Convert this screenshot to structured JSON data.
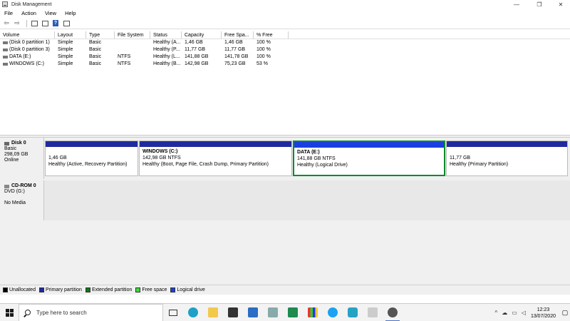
{
  "window": {
    "title": "Disk Management",
    "minimize": "—",
    "restore": "❐",
    "close": "✕"
  },
  "menu": [
    "File",
    "Action",
    "View",
    "Help"
  ],
  "toolbar": {
    "back": "⇦",
    "forward": "⇨",
    "help": "?"
  },
  "volume_table": {
    "columns": [
      "Volume",
      "Layout",
      "Type",
      "File System",
      "Status",
      "Capacity",
      "Free Spa...",
      "% Free"
    ],
    "rows": [
      {
        "volume": "(Disk 0 partition 1)",
        "layout": "Simple",
        "type": "Basic",
        "fs": "",
        "status": "Healthy (A...",
        "capacity": "1,46 GB",
        "free": "1,46 GB",
        "pct": "100 %"
      },
      {
        "volume": "(Disk 0 partition 3)",
        "layout": "Simple",
        "type": "Basic",
        "fs": "",
        "status": "Healthy (P...",
        "capacity": "11,77 GB",
        "free": "11,77 GB",
        "pct": "100 %"
      },
      {
        "volume": "DATA (E:)",
        "layout": "Simple",
        "type": "Basic",
        "fs": "NTFS",
        "status": "Healthy (L...",
        "capacity": "141,88 GB",
        "free": "141,78 GB",
        "pct": "100 %"
      },
      {
        "volume": "WINDOWS (C:)",
        "layout": "Simple",
        "type": "Basic",
        "fs": "NTFS",
        "status": "Healthy (B...",
        "capacity": "142,98 GB",
        "free": "75,23 GB",
        "pct": "53 %"
      }
    ]
  },
  "disk0": {
    "name": "Disk 0",
    "type": "Basic",
    "size": "298,09 GB",
    "state": "Online",
    "partitions": [
      {
        "title": "",
        "size": "1,46 GB",
        "status": "Healthy (Active, Recovery Partition)"
      },
      {
        "title": "WINDOWS  (C:)",
        "size": "142,98 GB NTFS",
        "status": "Healthy (Boot, Page File, Crash Dump, Primary Partition)"
      },
      {
        "title": "DATA  (E:)",
        "size": "141,88 GB NTFS",
        "status": "Healthy (Logical Drive)"
      },
      {
        "title": "",
        "size": "11,77 GB",
        "status": "Healthy (Primary Partition)"
      }
    ]
  },
  "cdrom0": {
    "name": "CD-ROM 0",
    "drive": "DVD (G:)",
    "media": "No Media"
  },
  "legend": [
    {
      "label": "Unallocated",
      "color": "#000000"
    },
    {
      "label": "Primary partition",
      "color": "#1e2a9e"
    },
    {
      "label": "Extended partition",
      "color": "#0a7a20"
    },
    {
      "label": "Free space",
      "color": "#3ddc3d"
    },
    {
      "label": "Logical drive",
      "color": "#1a3fe0"
    }
  ],
  "taskbar": {
    "search_placeholder": "Type here to search",
    "time": "12:23",
    "date": "13/07/2020",
    "tray": {
      "chevron": "^",
      "cloud": "☁",
      "network": "▭",
      "volume": "◁",
      "notify": "▢"
    }
  }
}
